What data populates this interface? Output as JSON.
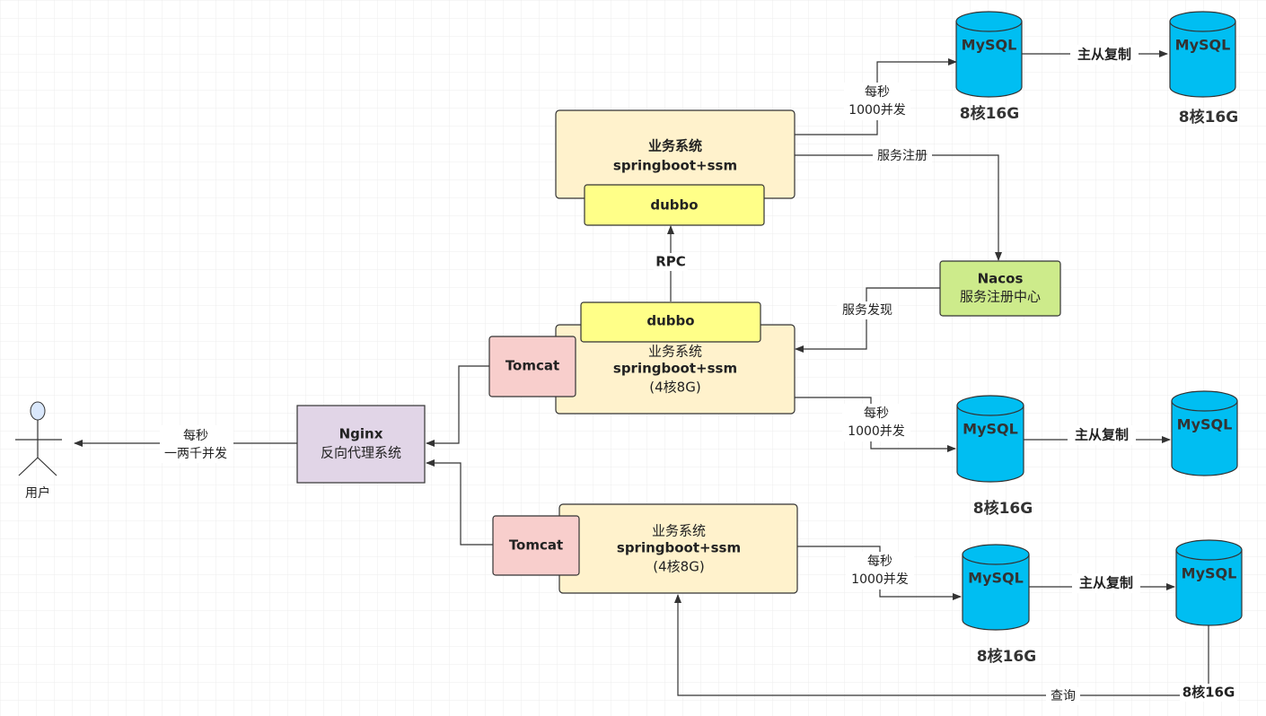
{
  "colors": {
    "business": "#fff2cc",
    "dubbo": "#ffff88",
    "tomcat": "#f8cecc",
    "nginx": "#e1d5e7",
    "nacos": "#cdeb8b",
    "mysql": "#00bef2",
    "actor_head": "#dae8fc"
  },
  "actor": {
    "label": "用户"
  },
  "user_edge": {
    "line1": "每秒",
    "line2": "一两千并发"
  },
  "nginx": {
    "line1": "Nginx",
    "line2": "反向代理系统"
  },
  "biz_top": {
    "line1": "业务系统",
    "line2": "springboot+ssm",
    "dubbo": "dubbo"
  },
  "biz_mid": {
    "line1": "业务系统",
    "line2": "springboot+ssm",
    "line3": "(4核8G)",
    "dubbo": "dubbo",
    "tomcat": "Tomcat"
  },
  "biz_bot": {
    "line1": "业务系统",
    "line2": "springboot+ssm",
    "line3": "(4核8G)",
    "tomcat": "Tomcat"
  },
  "rpc": "RPC",
  "nacos": {
    "line1": "Nacos",
    "line2": "服务注册中心"
  },
  "register": "服务注册",
  "discover": "服务发现",
  "qps": {
    "line1": "每秒",
    "line2": "1000并发"
  },
  "mysql": {
    "label": "MySQL",
    "spec": "8核16G"
  },
  "replication": "主从复制",
  "query": "查询"
}
